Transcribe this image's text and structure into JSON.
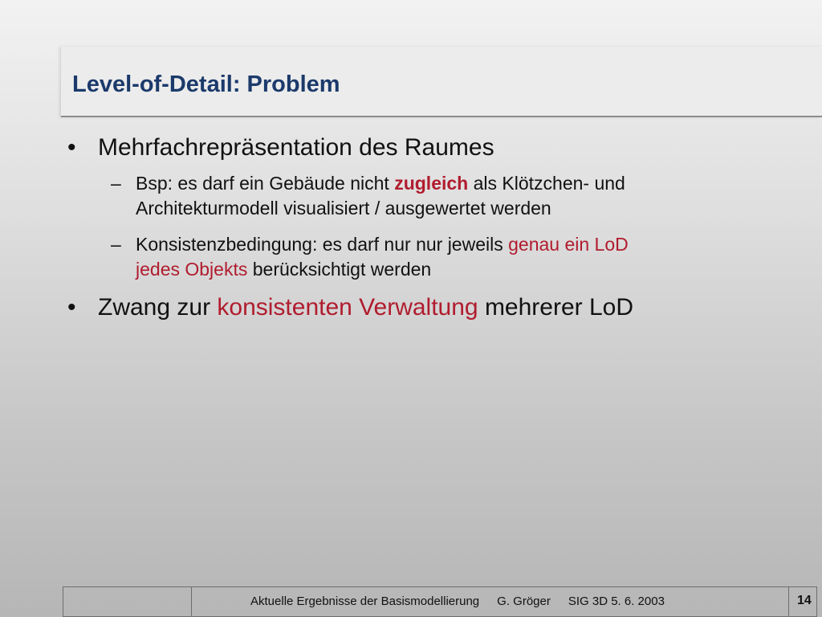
{
  "slide": {
    "title": "Level-of-Detail: Problem",
    "bullets": [
      {
        "marker": "•",
        "text": "Mehrfachrepräsentation des Raumes",
        "subs": [
          {
            "marker": "–",
            "line1_a": "Bsp: es darf ein Gebäude nicht ",
            "line1_hl": "zugleich",
            "line1_b": " als Klötzchen- und",
            "line2": "Architekturmodell  visualisiert / ausgewertet werden"
          },
          {
            "marker": "–",
            "line1_a": "Konsistenzbedingung: es darf nur nur jeweils ",
            "line1_hl": "genau ein LoD",
            "line2_hl": "jedes Objekts",
            "line2_b": " berücksichtigt werden"
          }
        ]
      },
      {
        "marker": "•",
        "text_a": "Zwang zur ",
        "text_hl": "konsistenten Verwaltung",
        "text_b": " mehrerer LoD"
      }
    ],
    "highlight_color": "#b01c2e",
    "title_color": "#1b3a6b"
  },
  "footer": {
    "talk": "Aktuelle Ergebnisse der Basismodellierung",
    "author": "G. Gröger",
    "event": "SIG 3D  5. 6. 2003",
    "page": "14"
  }
}
